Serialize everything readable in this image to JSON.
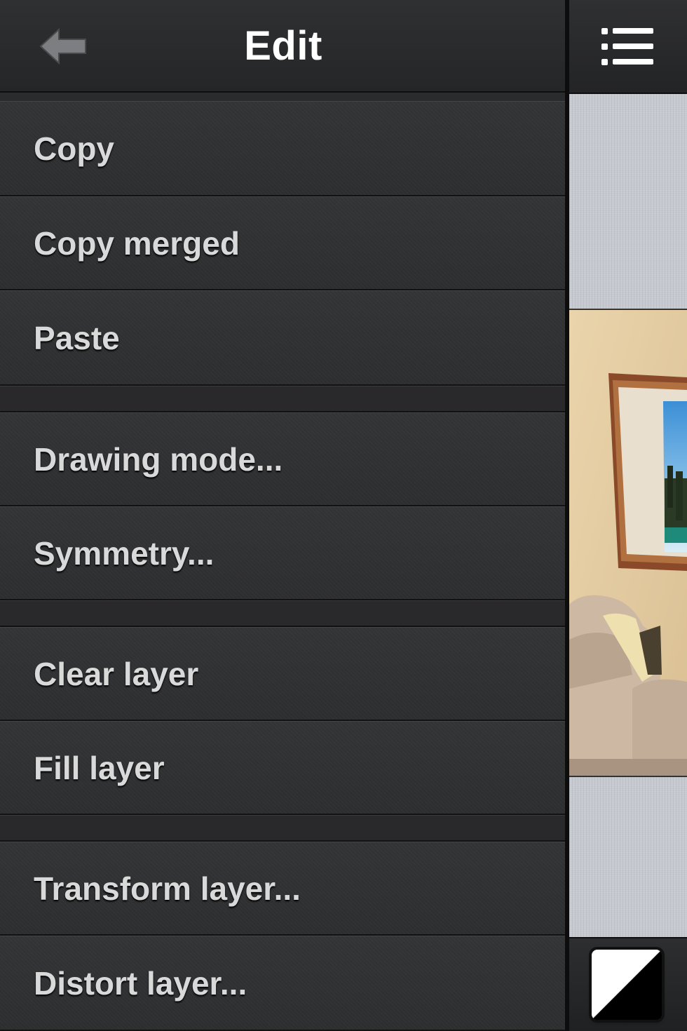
{
  "header": {
    "title": "Edit",
    "back_icon": "back-arrow-icon",
    "menu_icon": "list-menu-icon"
  },
  "menu": {
    "items": [
      {
        "label": "Copy"
      },
      {
        "label": "Copy merged"
      },
      {
        "label": "Paste"
      },
      {
        "label": "Drawing mode..."
      },
      {
        "label": "Symmetry..."
      },
      {
        "label": "Clear layer"
      },
      {
        "label": "Fill layer"
      },
      {
        "label": "Transform layer..."
      },
      {
        "label": "Distort layer..."
      }
    ]
  },
  "colors": {
    "primary": "#ffffff",
    "secondary": "#000000",
    "menu_text": "#d9d9d9"
  }
}
